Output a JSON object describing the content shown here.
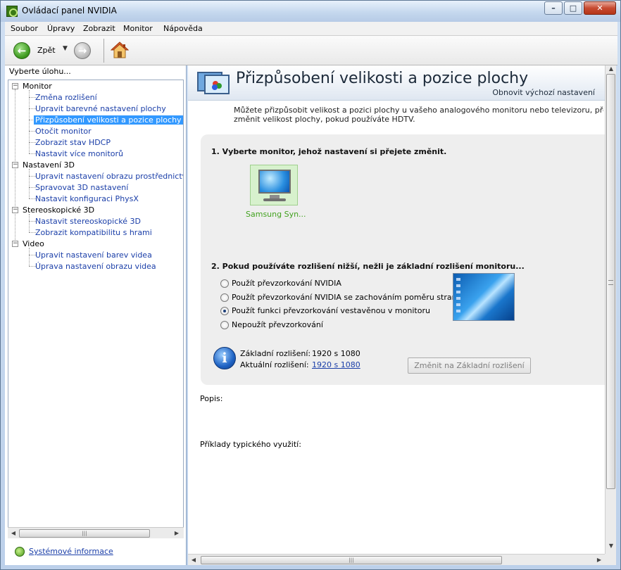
{
  "window": {
    "title": "Ovládací panel NVIDIA",
    "controls": {
      "minimize": "–",
      "maximize": "□",
      "close": "✕"
    }
  },
  "menu": {
    "items": [
      "Soubor",
      "Úpravy",
      "Zobrazit",
      "Monitor",
      "Nápověda"
    ]
  },
  "toolbar": {
    "back_label": "Zpět",
    "back_dropdown": "▼",
    "back_arrow": "←",
    "forward_arrow": "→",
    "home_icon": "home-icon"
  },
  "sidebar": {
    "header": "Vyberte úlohu...",
    "categories": [
      {
        "label": "Monitor",
        "expander": "−",
        "tasks": [
          "Změna rozlišení",
          "Upravit barevné nastavení plochy",
          "Přizpůsobení velikosti a pozice plochy",
          "Otočit monitor",
          "Zobrazit stav HDCP",
          "Nastavit více monitorů"
        ]
      },
      {
        "label": "Nastavení 3D",
        "expander": "−",
        "tasks": [
          "Upravit nastavení obrazu prostřednictvím n",
          "Spravovat 3D nastavení",
          "Nastavit konfiguraci PhysX"
        ]
      },
      {
        "label": "Stereoskopické 3D",
        "expander": "−",
        "tasks": [
          "Nastavit stereoskopické 3D",
          "Zobrazit kompatibilitu s hrami"
        ]
      },
      {
        "label": "Video",
        "expander": "−",
        "tasks": [
          "Upravit nastavení barev videa",
          "Úprava nastavení obrazu videa"
        ]
      }
    ],
    "selected_task": "Přizpůsobení velikosti a pozice plochy",
    "scroll_grip": "|||",
    "arrow_left": "◀",
    "arrow_right": "▶",
    "system_info_link": "Systémové informace"
  },
  "page": {
    "title": "Přizpůsobení velikosti a pozice plochy",
    "restore_defaults": "Obnovit výchozí nastavení",
    "description_line1": "Můžete přizpůsobit velikost a pozici plochy u vašeho analogového monitoru nebo televizoru, převzorkovat ploch",
    "description_line2": "změnit velikost plochy, pokud používáte HDTV.",
    "section1_title": "1. Vyberte monitor, jehož nastavení si přejete změnit.",
    "monitor_label": "Samsung Syn...",
    "section2_title": "2. Pokud používáte rozlišení nižší, nežli je základní rozlišení monitoru...",
    "scaling_options": [
      "Použít převzorkování NVIDIA",
      "Použít převzorkování NVIDIA se zachováním poměru stran",
      "Použít funkci převzorkování vestavěnou v monitoru",
      "Nepoužít převzorkování"
    ],
    "selected_option_index": 2,
    "native_resolution_label": "Základní rozlišení:",
    "native_resolution_value": "1920 s 1080",
    "current_resolution_label": "Aktuální rozlišení:",
    "current_resolution_value": "1920 s 1080",
    "change_to_native_button": "Změnit na Základní rozlišení",
    "info_glyph": "i",
    "description_label": "Popis:",
    "usage_examples_label": "Příklady typického využití:",
    "scroll_arrow_up": "▲",
    "scroll_arrow_down": "▼",
    "scroll_arrow_left": "◀",
    "scroll_arrow_right": "▶",
    "scroll_grip": "|||"
  },
  "colors": {
    "selection": "#3399ff",
    "link": "#1a3ea8",
    "monitor_label": "#42a21f",
    "nvidia_green": "#3a7a16"
  }
}
